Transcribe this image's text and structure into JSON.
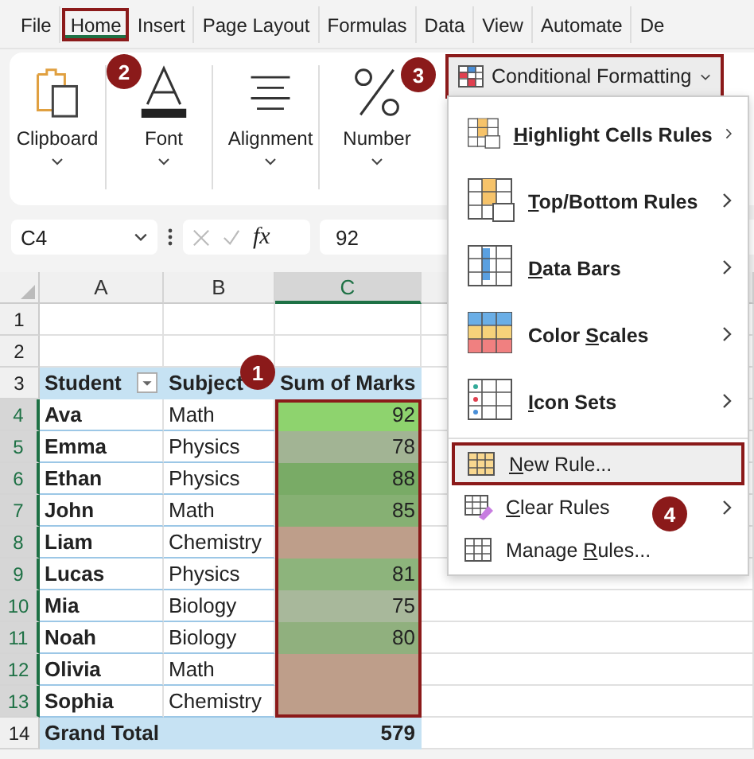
{
  "tabs": [
    {
      "label": "File",
      "selected": false
    },
    {
      "label": "Home",
      "selected": true
    },
    {
      "label": "Insert",
      "selected": false
    },
    {
      "label": "Page Layout",
      "selected": false
    },
    {
      "label": "Formulas",
      "selected": false
    },
    {
      "label": "Data",
      "selected": false
    },
    {
      "label": "View",
      "selected": false
    },
    {
      "label": "Automate",
      "selected": false
    },
    {
      "label": "De",
      "selected": false
    }
  ],
  "ribbon_groups": [
    {
      "label": "Clipboard"
    },
    {
      "label": "Font"
    },
    {
      "label": "Alignment"
    },
    {
      "label": "Number"
    }
  ],
  "cf_button": {
    "label": "Conditional Formatting"
  },
  "name_box": "C4",
  "formula_fx": "fx",
  "formula": "92",
  "columns": [
    {
      "label": "A",
      "selected": false
    },
    {
      "label": "B",
      "selected": false
    },
    {
      "label": "C",
      "selected": true
    }
  ],
  "rows": [
    {
      "num": "1",
      "kind": "blank",
      "selected": false
    },
    {
      "num": "2",
      "kind": "blank",
      "selected": false
    },
    {
      "num": "3",
      "kind": "header",
      "selected": false,
      "student": "Student",
      "subject": "Subject",
      "marks": "Sum of Marks"
    },
    {
      "num": "4",
      "kind": "data",
      "selected": true,
      "student": "Ava",
      "subject": "Math",
      "marks": "92",
      "color": "#8ed36e"
    },
    {
      "num": "5",
      "kind": "data",
      "selected": true,
      "student": "Emma",
      "subject": "Physics",
      "marks": "78",
      "color": "#a2b494"
    },
    {
      "num": "6",
      "kind": "data",
      "selected": true,
      "student": "Ethan",
      "subject": "Physics",
      "marks": "88",
      "color": "#79ab66"
    },
    {
      "num": "7",
      "kind": "data",
      "selected": true,
      "student": "John",
      "subject": "Math",
      "marks": "85",
      "color": "#86b073"
    },
    {
      "num": "8",
      "kind": "data",
      "selected": true,
      "student": "Liam",
      "subject": "Chemistry",
      "color": "#be9e8a"
    },
    {
      "num": "9",
      "kind": "data",
      "selected": true,
      "student": "Lucas",
      "subject": "Physics",
      "marks": "81",
      "color": "#8db47c"
    },
    {
      "num": "10",
      "kind": "data",
      "selected": true,
      "student": "Mia",
      "subject": "Biology",
      "marks": "75",
      "color": "#a8b89b"
    },
    {
      "num": "11",
      "kind": "data",
      "selected": true,
      "student": "Noah",
      "subject": "Biology",
      "marks": "80",
      "color": "#90b07e"
    },
    {
      "num": "12",
      "kind": "data",
      "selected": true,
      "student": "Olivia",
      "subject": "Math",
      "color": "#be9e8a"
    },
    {
      "num": "13",
      "kind": "data",
      "selected": true,
      "student": "Sophia",
      "subject": "Chemistry",
      "color": "#be9e8a"
    },
    {
      "num": "14",
      "kind": "total",
      "selected": false,
      "student": "Grand Total",
      "marks": "579"
    }
  ],
  "menu": {
    "items": [
      {
        "kind": "large",
        "key": "H",
        "post": "ighlight Cells Rules",
        "submenu": true,
        "selected": false
      },
      {
        "kind": "large",
        "key": "T",
        "post": "op/Bottom Rules",
        "submenu": true,
        "selected": false
      },
      {
        "kind": "large",
        "key": "D",
        "post": "ata Bars",
        "submenu": true,
        "selected": false
      },
      {
        "kind": "large",
        "pre": "Color ",
        "key": "S",
        "post": "cales",
        "submenu": true,
        "selected": false
      },
      {
        "kind": "large",
        "key": "I",
        "post": "con Sets",
        "submenu": true,
        "selected": false
      },
      {
        "kind": "small",
        "key": "N",
        "post": "ew Rule...",
        "submenu": false,
        "selected": true
      },
      {
        "kind": "small",
        "key": "C",
        "post": "lear Rules",
        "submenu": true,
        "selected": false
      },
      {
        "kind": "small",
        "pre": "Manage ",
        "key": "R",
        "post": "ules...",
        "submenu": false,
        "selected": false
      }
    ]
  },
  "badges": [
    {
      "text": "1"
    },
    {
      "text": "2"
    },
    {
      "text": "3"
    },
    {
      "text": "4"
    }
  ]
}
